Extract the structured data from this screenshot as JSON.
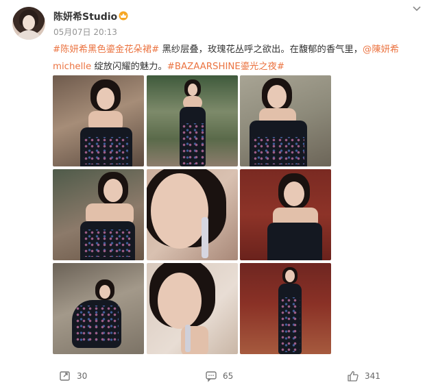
{
  "post": {
    "author": "陈妍希Studio",
    "timestamp": "05月07日 20:13",
    "text": {
      "tag1": "#陈妍希黑色鎏金花朵裙#",
      "body1": " 黑纱层叠，玫瑰花丛呼之欲出。在馥郁的香气里，",
      "mention": "@陳妍希michelle",
      "body2": " 绽放闪耀的魅力。",
      "tag2": "#BAZAARSHINE鎏光之夜#"
    },
    "photos": [
      {
        "name": "photo-1"
      },
      {
        "name": "photo-2"
      },
      {
        "name": "photo-3"
      },
      {
        "name": "photo-4"
      },
      {
        "name": "photo-5"
      },
      {
        "name": "photo-6"
      },
      {
        "name": "photo-7"
      },
      {
        "name": "photo-8"
      },
      {
        "name": "photo-9"
      }
    ]
  },
  "actions": {
    "repost_count": "30",
    "comment_count": "65",
    "like_count": "341"
  },
  "colors": {
    "accent": "#eb7340",
    "meta_gray": "#939393",
    "text": "#333333"
  },
  "icons": [
    "chevron-down-icon",
    "crown-badge-icon",
    "repost-icon",
    "comment-icon",
    "like-icon"
  ]
}
